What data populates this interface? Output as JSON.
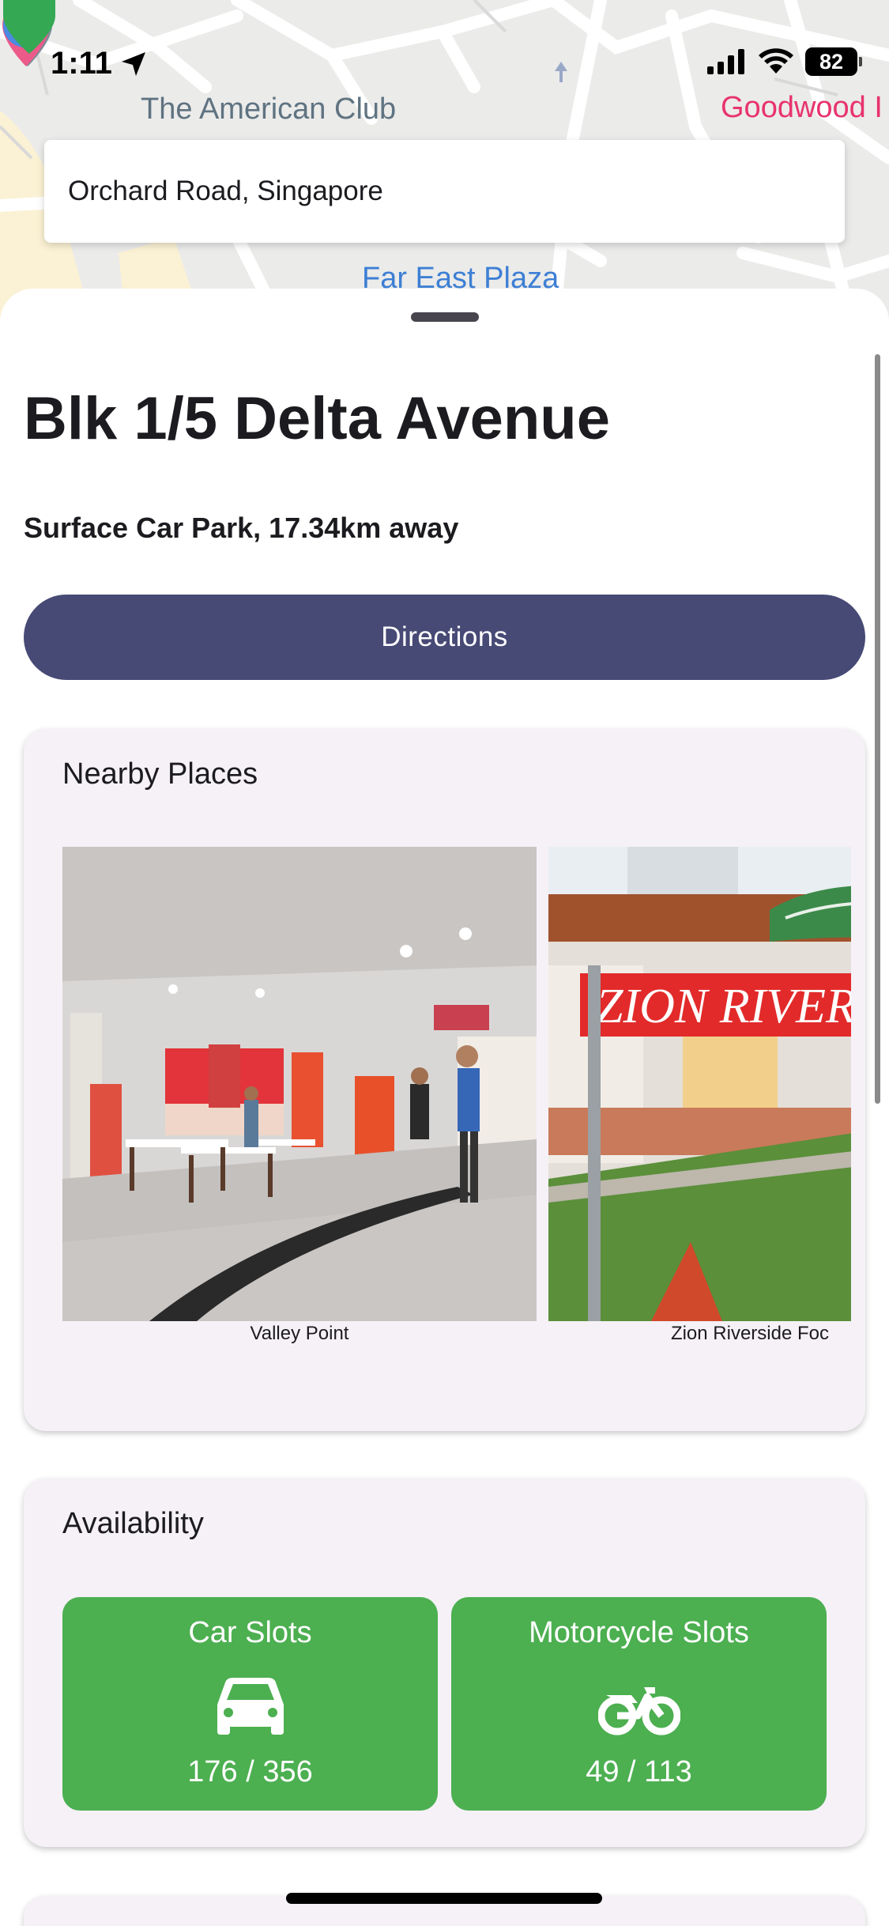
{
  "status_bar": {
    "time": "1:11",
    "battery": "82"
  },
  "map": {
    "labels": {
      "american_club": "The American Club",
      "goodwood": "Goodwood I",
      "far_east": "Far East Plaza"
    }
  },
  "search": {
    "value": "Orchard Road, Singapore"
  },
  "carpark": {
    "name": "Blk 1/5 Delta Avenue",
    "subtitle": "Surface Car Park, 17.34km away",
    "directions_label": "Directions"
  },
  "nearby": {
    "title": "Nearby Places",
    "places": [
      {
        "name": "Valley Point"
      },
      {
        "name": "Zion Riverside Foc"
      }
    ],
    "sign_text": "ZION RIVER"
  },
  "availability": {
    "title": "Availability",
    "car": {
      "label": "Car Slots",
      "count": "176 / 356",
      "icon": "car-icon"
    },
    "motorcycle": {
      "label": "Motorcycle Slots",
      "count": "49 / 113",
      "icon": "motorcycle-icon"
    },
    "color": "#4caf50"
  },
  "colors": {
    "primary": "#474a75",
    "card_bg": "#f5f1f7"
  }
}
